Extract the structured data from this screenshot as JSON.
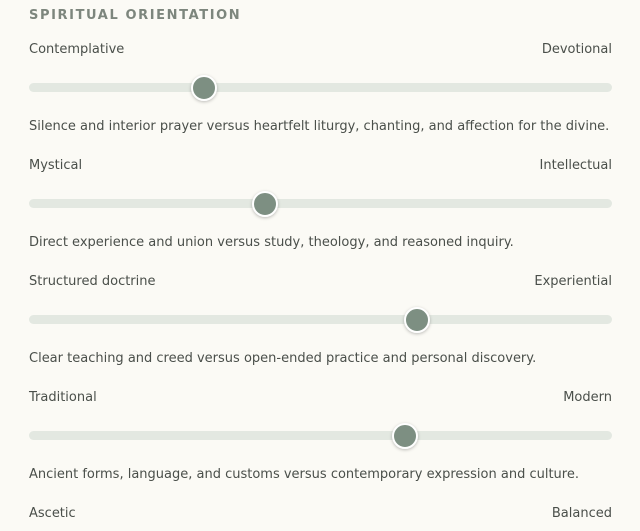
{
  "section": {
    "title": "SPIRITUAL ORIENTATION"
  },
  "sliders": [
    {
      "left": "Contemplative",
      "right": "Devotional",
      "value": 0.3,
      "description": "Silence and interior prayer versus heartfelt liturgy, chanting, and affection for the divine."
    },
    {
      "left": "Mystical",
      "right": "Intellectual",
      "value": 0.405,
      "description": "Direct experience and union versus study, theology, and reasoned inquiry."
    },
    {
      "left": "Structured doctrine",
      "right": "Experiential",
      "value": 0.665,
      "description": "Clear teaching and creed versus open-ended practice and personal discovery."
    },
    {
      "left": "Traditional",
      "right": "Modern",
      "value": 0.645,
      "description": "Ancient forms, language, and customs versus contemporary expression and culture."
    },
    {
      "left": "Ascetic",
      "right": "Balanced"
    }
  ],
  "colors": {
    "accent": "#7d8f82",
    "track": "#e3e8e1",
    "background": "#fbfaf5"
  }
}
